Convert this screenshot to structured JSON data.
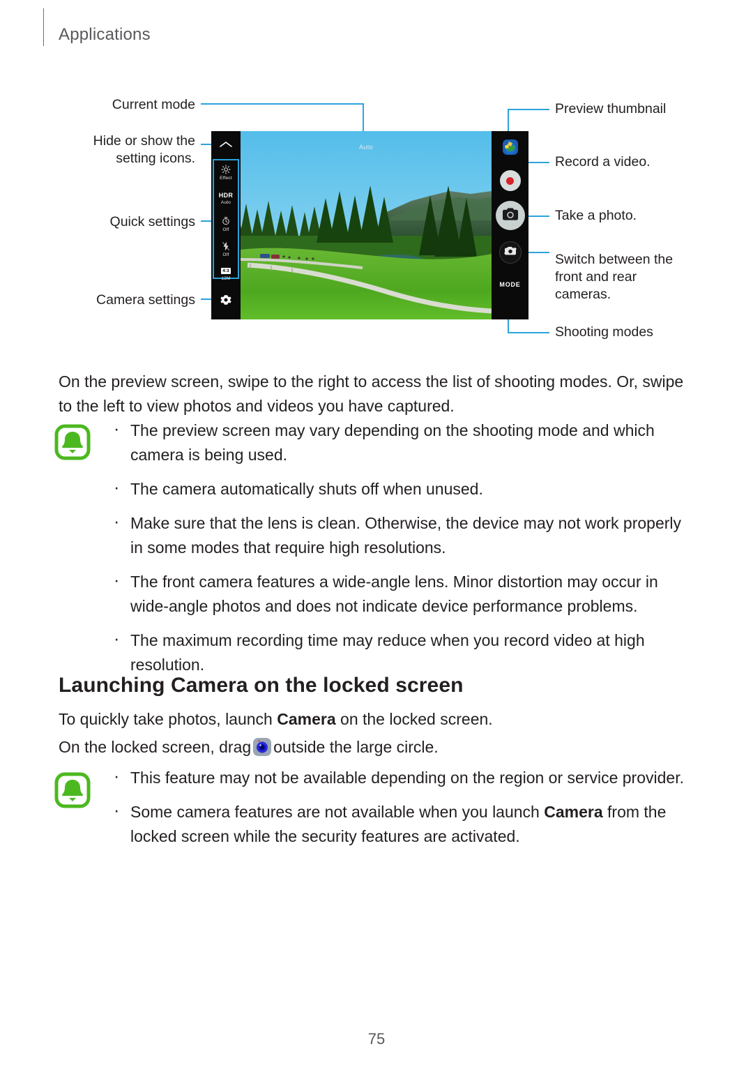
{
  "header": {
    "section": "Applications"
  },
  "page": {
    "number": "75"
  },
  "diagram": {
    "labels": {
      "current_mode": "Current mode",
      "hide_show": "Hide or show the\nsetting icons.",
      "quick_settings": "Quick settings",
      "camera_settings": "Camera settings",
      "preview_thumbnail": "Preview thumbnail",
      "record_video": "Record a video.",
      "take_photo": "Take a photo.",
      "switch_cameras": "Switch between the\nfront and rear\ncameras.",
      "shooting_modes": "Shooting modes"
    },
    "screen": {
      "mode_indicator": "Auto",
      "mode_button": "MODE",
      "quick_settings": [
        {
          "icon": "effect-icon",
          "label": "Effect",
          "value": ""
        },
        {
          "icon": "hdr-icon",
          "label": "HDR",
          "value": "Auto"
        },
        {
          "icon": "timer-icon",
          "label": "",
          "value": "Off"
        },
        {
          "icon": "flash-off-icon",
          "label": "",
          "value": "Off"
        },
        {
          "icon": "aspect-ratio-icon",
          "label": "4:3",
          "value": "12M"
        }
      ]
    },
    "accent_color": "#2ba3dd"
  },
  "content": {
    "intro": "On the preview screen, swipe to the right to access the list of shooting modes. Or, swipe to the left to view photos and videos you have captured.",
    "note_one": [
      "The preview screen may vary depending on the shooting mode and which camera is being used.",
      "The camera automatically shuts off when unused.",
      "Make sure that the lens is clean. Otherwise, the device may not work properly in some modes that require high resolutions.",
      "The front camera features a wide-angle lens. Minor distortion may occur in wide-angle photos and does not indicate device performance problems.",
      "The maximum recording time may reduce when you record video at high resolution."
    ],
    "section_title": "Launching Camera on the locked screen",
    "locked_line1_a": "To quickly take photos, launch ",
    "locked_line1_b": "Camera",
    "locked_line1_c": " on the locked screen.",
    "locked_line2_a": "On the locked screen, drag",
    "locked_line2_b": "outside the large circle.",
    "note_two": [
      {
        "a": "This feature may not be available depending on the region or service provider.",
        "b": "",
        "c": ""
      },
      {
        "a": "Some camera features are not available when you launch ",
        "b": "Camera",
        "c": " from the locked screen while the security features are activated."
      }
    ]
  },
  "colors": {
    "accent": "#2ba3dd",
    "note_green": "#4cb820",
    "record_red": "#d8232a"
  }
}
